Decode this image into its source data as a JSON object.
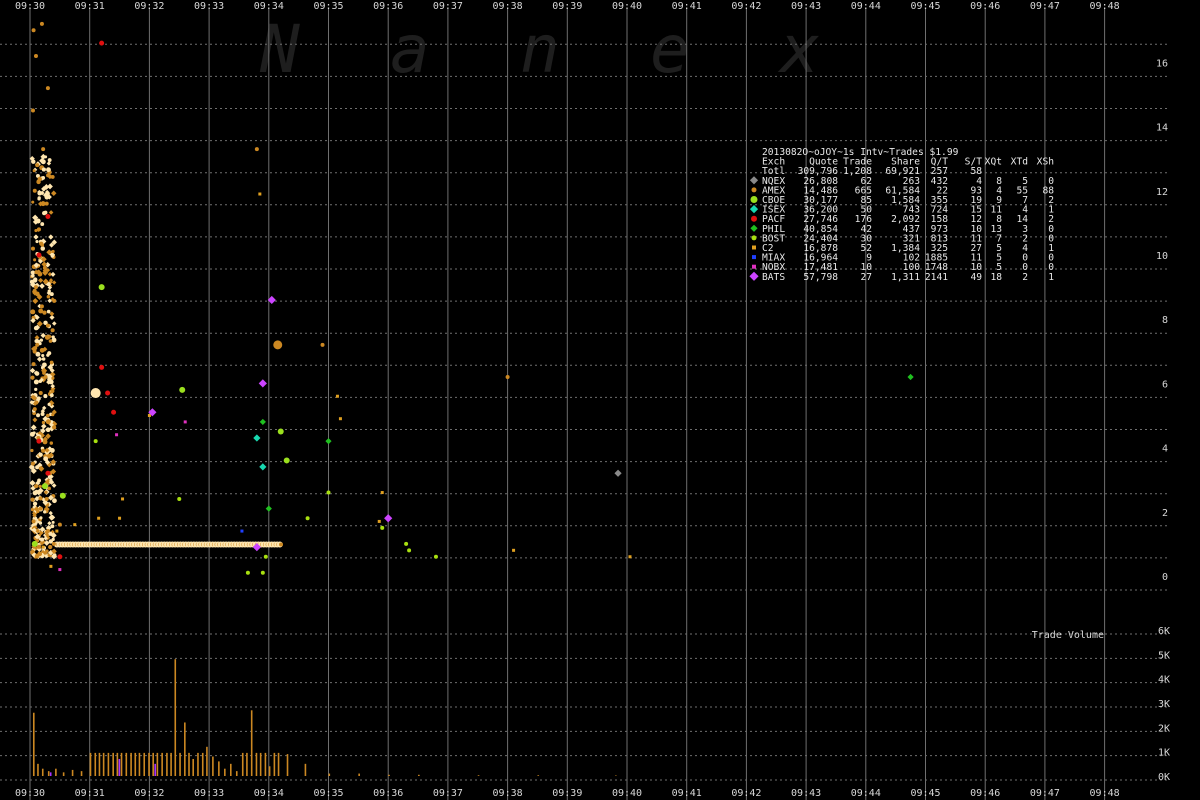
{
  "chart_data": [
    {
      "type": "scatter",
      "title": "2013082O~oJOY~1s Intv~Trades $1.99",
      "watermark": "Nanex",
      "x_ticks": [
        "09:30",
        "09:31",
        "09:32",
        "09:33",
        "09:34",
        "09:35",
        "09:36",
        "09:37",
        "09:38",
        "09:39",
        "09:40",
        "09:41",
        "09:42",
        "09:43",
        "09:44",
        "09:45",
        "09:46",
        "09:47",
        "09:48"
      ],
      "x_range_minutes": [
        0,
        18
      ],
      "ylim": [
        -0.5,
        17.5
      ],
      "y_ticks": [
        0,
        2,
        4,
        6,
        8,
        10,
        12,
        14,
        16
      ],
      "grid": true,
      "legend_position": "top-right",
      "legend": {
        "header": [
          "Exch",
          "Quote",
          "Trade",
          "Share",
          "Q/T",
          "S/T",
          "XQt",
          "XTd",
          "XSh"
        ],
        "total": [
          "Totl",
          "309,796",
          "1,208",
          "69,921",
          "257",
          "58",
          "",
          "",
          ""
        ],
        "rows": [
          {
            "exch": "NQEX",
            "marker": "diamond",
            "color": "#8a8a8a",
            "size": 6,
            "values": [
              "26,808",
              "62",
              "263",
              "432",
              "4",
              "8",
              "5",
              "0"
            ]
          },
          {
            "exch": "AMEX",
            "marker": "circle",
            "color": "#cc8822",
            "size": 4,
            "values": [
              "14,486",
              "665",
              "61,584",
              "22",
              "93",
              "4",
              "55",
              "88"
            ]
          },
          {
            "exch": "CBOE",
            "marker": "circle",
            "color": "#9be01e",
            "size": 6,
            "values": [
              "30,177",
              "85",
              "1,584",
              "355",
              "19",
              "9",
              "7",
              "2"
            ]
          },
          {
            "exch": "ISEX",
            "marker": "diamond",
            "color": "#18d8b0",
            "size": 6,
            "values": [
              "36,200",
              "50",
              "743",
              "724",
              "15",
              "11",
              "4",
              "1"
            ]
          },
          {
            "exch": "PACF",
            "marker": "circle",
            "color": "#e01010",
            "size": 5,
            "values": [
              "27,746",
              "176",
              "2,092",
              "158",
              "12",
              "8",
              "14",
              "2"
            ]
          },
          {
            "exch": "PHIL",
            "marker": "diamond",
            "color": "#20c020",
            "size": 5,
            "values": [
              "40,854",
              "42",
              "437",
              "973",
              "10",
              "13",
              "3",
              "0"
            ]
          },
          {
            "exch": "BOST",
            "marker": "circle",
            "color": "#a8e010",
            "size": 4,
            "values": [
              "24,404",
              "30",
              "321",
              "813",
              "11",
              "7",
              "2",
              "0"
            ]
          },
          {
            "exch": "C2",
            "marker": "square",
            "color": "#e0a020",
            "size": 3,
            "values": [
              "16,878",
              "52",
              "1,384",
              "325",
              "27",
              "5",
              "4",
              "1"
            ]
          },
          {
            "exch": "MIAX",
            "marker": "square",
            "color": "#2040ff",
            "size": 3,
            "values": [
              "16,964",
              "9",
              "102",
              "1885",
              "11",
              "5",
              "0",
              "0"
            ]
          },
          {
            "exch": "NOBX",
            "marker": "square",
            "color": "#e030c0",
            "size": 3,
            "values": [
              "17,481",
              "10",
              "100",
              "1748",
              "10",
              "5",
              "0",
              "0"
            ]
          },
          {
            "exch": "BATS",
            "marker": "diamond",
            "color": "#cc44ff",
            "size": 7,
            "values": [
              "57,798",
              "27",
              "1,311",
              "2141",
              "49",
              "18",
              "2",
              "1"
            ]
          }
        ]
      },
      "series": [
        {
          "name": "NQEX",
          "points": [
            [
              9.85,
              3.2
            ]
          ]
        },
        {
          "name": "AMEX",
          "points": [
            [
              0.06,
              17.0
            ],
            [
              0.2,
              17.2
            ],
            [
              0.1,
              16.2
            ],
            [
              0.3,
              15.2
            ],
            [
              0.05,
              14.5
            ],
            [
              0.22,
              13.3
            ],
            [
              0.12,
              12.8
            ],
            [
              0.08,
              12.0
            ],
            [
              0.28,
              11.6
            ],
            [
              0.15,
              10.8
            ],
            [
              0.05,
              10.2
            ],
            [
              0.25,
              9.6
            ],
            [
              0.1,
              9.0
            ],
            [
              0.2,
              8.4
            ],
            [
              0.3,
              7.8
            ],
            [
              0.12,
              7.2
            ],
            [
              0.06,
              6.6
            ],
            [
              0.26,
              6.2
            ],
            [
              0.18,
              5.7
            ],
            [
              0.08,
              5.2
            ],
            [
              0.3,
              4.8
            ],
            [
              0.14,
              4.3
            ],
            [
              0.22,
              3.9
            ],
            [
              0.05,
              3.5
            ],
            [
              0.34,
              3.2
            ],
            [
              0.1,
              2.8
            ],
            [
              0.28,
              2.4
            ],
            [
              0.18,
              2.1
            ],
            [
              0.06,
              1.7
            ],
            [
              0.3,
              1.4
            ],
            [
              0.12,
              1.1
            ],
            [
              0.4,
              1.0
            ],
            [
              0.5,
              1.6
            ],
            [
              3.8,
              13.3
            ],
            [
              8.0,
              6.2
            ],
            [
              4.9,
              7.2
            ]
          ]
        },
        {
          "name": "CBOE",
          "points": [
            [
              0.55,
              2.5
            ],
            [
              0.25,
              2.8
            ],
            [
              1.2,
              9.0
            ],
            [
              2.55,
              5.8
            ],
            [
              4.2,
              4.5
            ],
            [
              4.3,
              3.6
            ],
            [
              0.08,
              1.0
            ]
          ]
        },
        {
          "name": "ISEX",
          "points": [
            [
              3.8,
              4.3
            ],
            [
              3.9,
              3.4
            ]
          ]
        },
        {
          "name": "PACF",
          "points": [
            [
              1.2,
              16.6
            ],
            [
              0.3,
              11.2
            ],
            [
              0.15,
              10.0
            ],
            [
              1.2,
              6.5
            ],
            [
              1.3,
              5.7
            ],
            [
              1.4,
              5.1
            ],
            [
              0.15,
              4.2
            ],
            [
              0.3,
              3.2
            ],
            [
              0.5,
              0.6
            ]
          ]
        },
        {
          "name": "PHIL",
          "points": [
            [
              14.75,
              6.2
            ],
            [
              5.0,
              4.2
            ],
            [
              3.9,
              4.8
            ],
            [
              4.0,
              2.1
            ]
          ]
        },
        {
          "name": "BOST",
          "points": [
            [
              1.1,
              4.2
            ],
            [
              2.5,
              2.4
            ],
            [
              5.0,
              2.6
            ],
            [
              4.65,
              1.8
            ],
            [
              5.9,
              1.5
            ],
            [
              6.3,
              1.0
            ],
            [
              6.35,
              0.8
            ],
            [
              6.8,
              0.6
            ],
            [
              3.95,
              0.6
            ],
            [
              3.65,
              0.1
            ],
            [
              3.9,
              0.1
            ]
          ]
        },
        {
          "name": "C2",
          "points": [
            [
              3.85,
              11.9
            ],
            [
              5.15,
              5.6
            ],
            [
              5.2,
              4.9
            ],
            [
              1.55,
              2.4
            ],
            [
              1.5,
              1.8
            ],
            [
              1.15,
              1.8
            ],
            [
              0.75,
              1.6
            ],
            [
              0.45,
              1.4
            ],
            [
              0.22,
              0.9
            ],
            [
              0.35,
              0.3
            ],
            [
              5.9,
              2.6
            ],
            [
              2.0,
              5.0
            ],
            [
              5.85,
              1.7
            ],
            [
              8.1,
              0.8
            ],
            [
              10.05,
              0.6
            ]
          ]
        },
        {
          "name": "MIAX",
          "points": [
            [
              3.55,
              1.4
            ]
          ]
        },
        {
          "name": "NOBX",
          "points": [
            [
              0.5,
              0.2
            ],
            [
              2.6,
              4.8
            ],
            [
              1.45,
              4.4
            ]
          ]
        },
        {
          "name": "BATS",
          "points": [
            [
              4.05,
              8.6
            ],
            [
              2.05,
              5.1
            ],
            [
              3.9,
              6.0
            ],
            [
              3.8,
              0.9
            ],
            [
              6.0,
              1.8
            ]
          ]
        }
      ]
    },
    {
      "type": "bar",
      "title": "Trade Volume",
      "ylim": [
        0,
        6000
      ],
      "y_ticks": [
        "0K",
        "1K",
        "2K",
        "3K",
        "4K",
        "5K",
        "6K"
      ],
      "y_tick_values": [
        0,
        1000,
        2000,
        3000,
        4000,
        5000,
        6000
      ],
      "x": [
        0.05,
        0.12,
        0.2,
        0.3,
        0.42,
        0.55,
        0.7,
        0.85,
        1.0,
        1.08,
        1.15,
        1.22,
        1.3,
        1.38,
        1.45,
        1.52,
        1.6,
        1.68,
        1.75,
        1.82,
        1.9,
        1.98,
        2.05,
        2.12,
        2.2,
        2.28,
        2.35,
        2.42,
        2.5,
        2.58,
        2.65,
        2.72,
        2.8,
        2.88,
        2.95,
        3.05,
        3.15,
        3.25,
        3.35,
        3.45,
        3.55,
        3.62,
        3.7,
        3.78,
        3.85,
        3.93,
        4.0,
        4.08,
        4.15,
        4.3,
        4.6,
        5.0,
        5.5,
        6.0,
        6.5,
        7.5,
        8.5,
        9.8
      ],
      "values": [
        2600,
        500,
        300,
        200,
        300,
        150,
        250,
        200,
        950,
        950,
        950,
        950,
        950,
        950,
        950,
        950,
        950,
        950,
        950,
        950,
        950,
        950,
        950,
        950,
        950,
        950,
        950,
        4800,
        950,
        2200,
        950,
        700,
        950,
        950,
        1200,
        800,
        600,
        300,
        500,
        200,
        950,
        950,
        2700,
        950,
        950,
        950,
        400,
        950,
        950,
        900,
        500,
        100,
        100,
        50,
        50,
        30,
        30,
        20
      ]
    }
  ],
  "colors": {
    "background": "#000000",
    "grid": "#6f6f6f",
    "amex_bar": "#cc8822",
    "accent_bar": "#aa33ff"
  }
}
